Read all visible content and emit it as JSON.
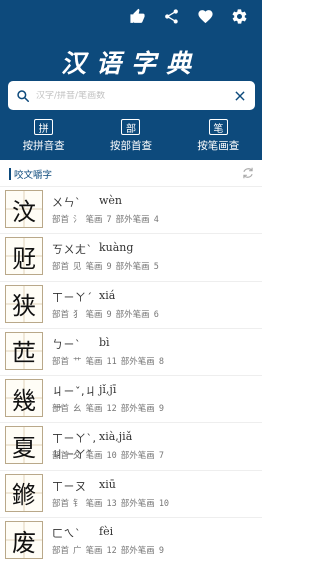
{
  "header": {
    "icons": [
      "thumbs-up-icon",
      "share-icon",
      "heart-icon",
      "gear-icon"
    ],
    "title": "汉语字典",
    "bg_color": "#0d4a7c"
  },
  "search": {
    "placeholder": "汉字/拼音/笔画数"
  },
  "modes": [
    {
      "box": "拼",
      "label": "按拼音查"
    },
    {
      "box": "部",
      "label": "按部首查"
    },
    {
      "box": "笔",
      "label": "按笔画查"
    }
  ],
  "section": {
    "title": "咬文嚼字"
  },
  "labels": {
    "bushou": "部首",
    "bihua": "笔画",
    "buwai": "部外笔画"
  },
  "entries": [
    {
      "char": "汶",
      "zhuyin": "ㄨㄣˋ",
      "pinyin": "wèn",
      "radical": "氵",
      "strokes": "7",
      "extra": "4"
    },
    {
      "char": "觃",
      "zhuyin": "ㄎㄨㄤˋ",
      "pinyin": "kuàng",
      "radical": "见",
      "strokes": "9",
      "extra": "5"
    },
    {
      "char": "狭",
      "zhuyin": "ㄒㄧㄚˊ",
      "pinyin": "xiá",
      "radical": "犭",
      "strokes": "9",
      "extra": "6"
    },
    {
      "char": "苉",
      "zhuyin": "ㄅㄧˋ",
      "pinyin": "bì",
      "radical": "艹",
      "strokes": "11",
      "extra": "8"
    },
    {
      "char": "幾",
      "zhuyin": "ㄐㄧˇ,ㄐㄧ",
      "pinyin": "jǐ,jī",
      "radical": "幺",
      "strokes": "12",
      "extra": "9"
    },
    {
      "char": "夏",
      "zhuyin": "ㄒㄧㄚˋ,ㄐㄧㄚˇ",
      "pinyin": "xià,jiǎ",
      "radical": "夂",
      "strokes": "10",
      "extra": "7"
    },
    {
      "char": "鎀",
      "zhuyin": "ㄒㄧㄡ",
      "pinyin": "xiū",
      "radical": "钅",
      "strokes": "13",
      "extra": "10"
    },
    {
      "char": "废",
      "zhuyin": "ㄈㄟˋ",
      "pinyin": "fèi",
      "radical": "广",
      "strokes": "12",
      "extra": "9"
    }
  ]
}
